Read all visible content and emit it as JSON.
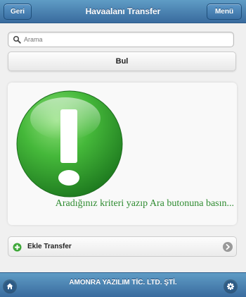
{
  "header": {
    "title": "Havaalanı Transfer",
    "back_label": "Geri",
    "menu_label": "Menü"
  },
  "search": {
    "placeholder": "Arama",
    "value": "",
    "icon": "search-icon"
  },
  "search_button": {
    "label": "Bul"
  },
  "message": {
    "icon": "exclamation-icon",
    "text": "Aradığınız kriteri yazıp Ara butonuna basın..."
  },
  "add_item": {
    "label": "Ekle Transfer",
    "icon": "plus-circle-icon",
    "arrow_icon": "chevron-right-icon"
  },
  "footer": {
    "title": "AMONRA YAZILIM TİC. LTD. ŞTİ.",
    "left_icon": "home-icon",
    "right_icon": "gear-icon"
  },
  "colors": {
    "header": "#4a82b5",
    "accent_green": "#3fa83a",
    "message_text": "#2e8b30"
  }
}
